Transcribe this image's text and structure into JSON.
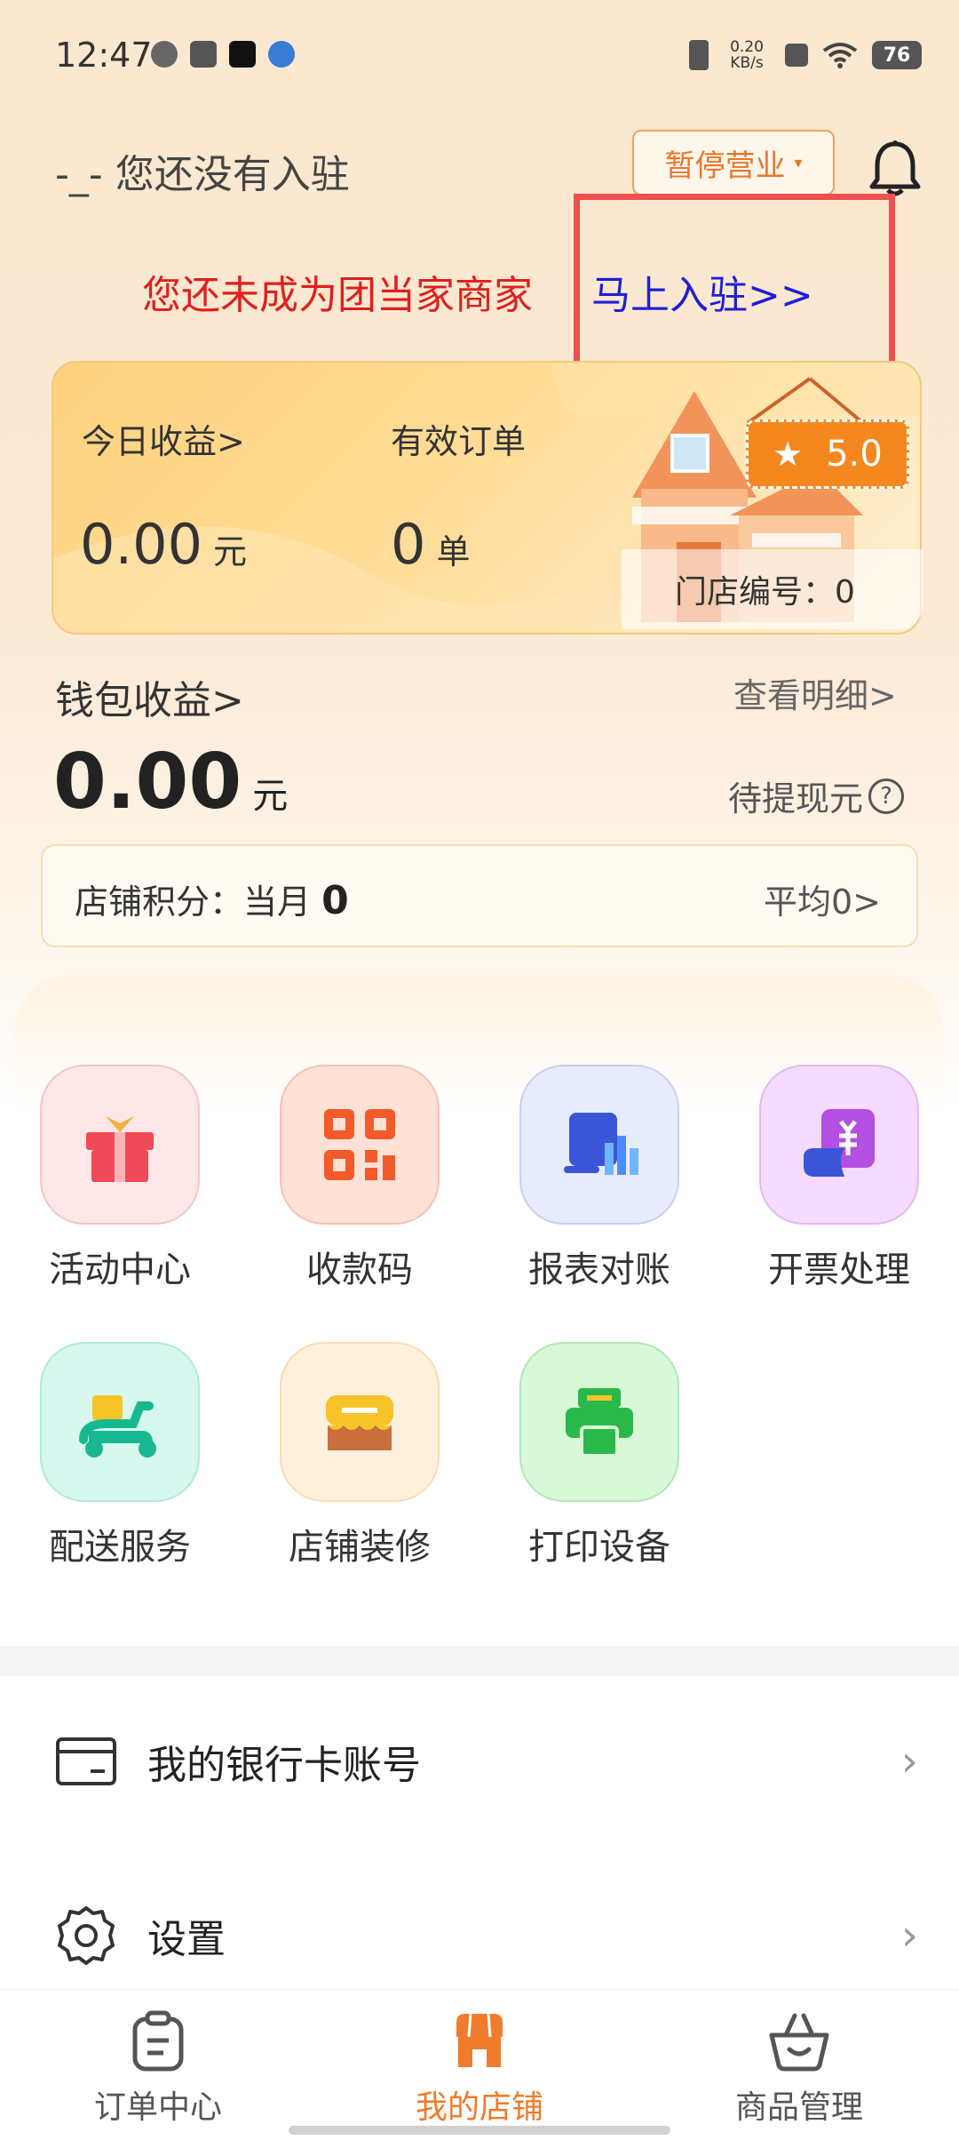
{
  "status_bar": {
    "time": "12:47",
    "net_speed": "0.20 KB/s",
    "battery": "76"
  },
  "header": {
    "shop_name": "-_- 您还没有入驻",
    "pause_button": "暂停营业",
    "bell_icon": "bell-icon"
  },
  "banner": {
    "text": "您还未成为团当家商家",
    "link": "马上入驻>>"
  },
  "earnings": {
    "today_label": "今日收益>",
    "today_value": "0.00",
    "today_unit": "元",
    "orders_label": "有效订单",
    "orders_value": "0",
    "orders_unit": "单",
    "rating": "5.0",
    "store_no": "门店编号：0"
  },
  "wallet": {
    "label": "钱包收益>",
    "view_detail": "查看明细>",
    "value": "0.00",
    "unit": "元",
    "pending": "待提现元"
  },
  "score": {
    "label": "店铺积分：当月",
    "month_value": "0",
    "average": "平均0>"
  },
  "grid": [
    {
      "label": "活动中心",
      "icon": "gift-icon"
    },
    {
      "label": "收款码",
      "icon": "qrcode-icon"
    },
    {
      "label": "报表对账",
      "icon": "report-icon"
    },
    {
      "label": "开票处理",
      "icon": "invoice-icon"
    },
    {
      "label": "配送服务",
      "icon": "scooter-icon"
    },
    {
      "label": "店铺装修",
      "icon": "shop-decor-icon"
    },
    {
      "label": "打印设备",
      "icon": "printer-icon"
    }
  ],
  "rows": [
    {
      "label": "我的银行卡账号",
      "icon": "bank-card-icon"
    },
    {
      "label": "设置",
      "icon": "settings-icon"
    }
  ],
  "tabs": [
    {
      "label": "订单中心",
      "icon": "order-icon"
    },
    {
      "label": "我的店铺",
      "icon": "shop-icon"
    },
    {
      "label": "商品管理",
      "icon": "basket-icon"
    }
  ],
  "colors": {
    "accent": "#f07b2a",
    "banner_red": "#e0201d",
    "banner_blue": "#1f1fd6",
    "highlight_box": "#ee5050"
  }
}
